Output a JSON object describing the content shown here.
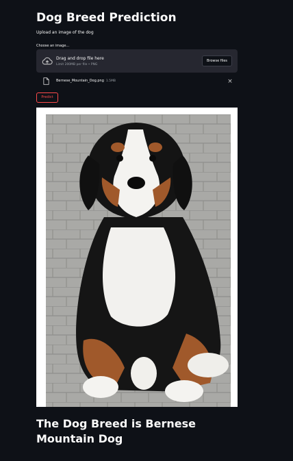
{
  "page": {
    "title": "Dog Breed Prediction",
    "subtitle": "Upload an image of the dog"
  },
  "uploader": {
    "label": "Choose an image...",
    "dropzone_text": "Drag and drop file here",
    "limit_text": "Limit 200MB per file • PNG",
    "browse_label": "Browse files",
    "icon": "cloud-upload-icon"
  },
  "file": {
    "name": "Bernese_Mountain_Dog.png",
    "size": "1.5MB",
    "icon": "file-icon",
    "remove_icon": "close-icon",
    "remove_glyph": "×"
  },
  "predict": {
    "label": "Predict"
  },
  "result": {
    "text": "The Dog Breed is Bernese Mountain Dog"
  },
  "colors": {
    "background": "#0e1117",
    "surface": "#262730",
    "accent": "#ff4b4b",
    "text": "#fafafa"
  }
}
